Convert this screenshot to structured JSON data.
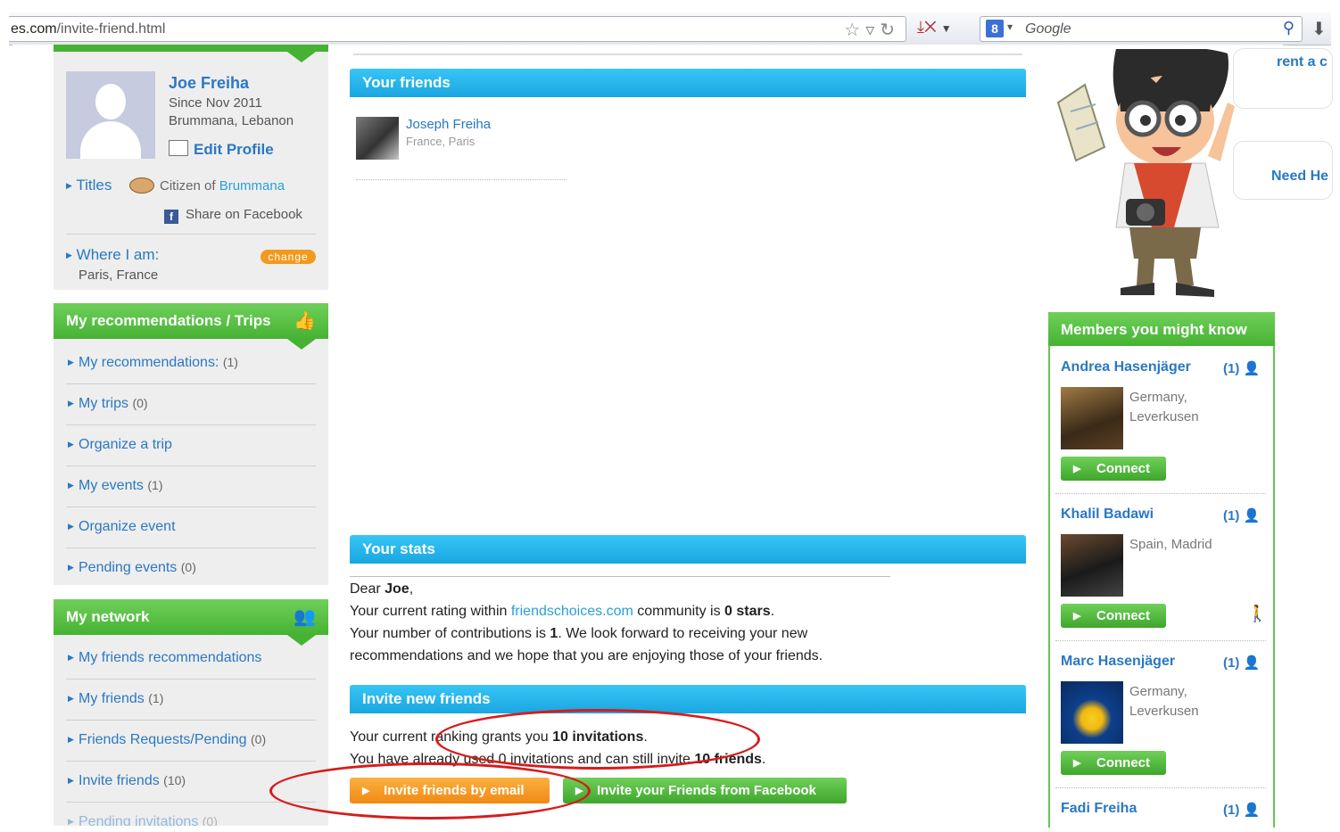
{
  "browser": {
    "url_domain": "es.com",
    "url_path": "/invite-friend.html",
    "search_placeholder": "Google",
    "search_engine_letter": "8"
  },
  "profile": {
    "name": "Joe Freiha",
    "since": "Since Nov 2011",
    "town": "Brummana, Lebanon",
    "edit_label": "Edit Profile",
    "titles_label": "Titles",
    "citizen_prefix": "Citizen of",
    "citizen_place": "Brummana",
    "share_label": "Share on Facebook",
    "where_label": "Where I am:",
    "change_label": "change",
    "location": "Paris, France"
  },
  "recommendations": {
    "title": "My recommendations / Trips",
    "items": [
      {
        "label": "My recommendations:",
        "count": "(1)"
      },
      {
        "label": "My trips",
        "count": "(0)"
      },
      {
        "label": "Organize a trip",
        "count": ""
      },
      {
        "label": "My events",
        "count": "(1)"
      },
      {
        "label": "Organize event",
        "count": ""
      },
      {
        "label": "Pending events",
        "count": "(0)"
      }
    ]
  },
  "network": {
    "title": "My network",
    "items": [
      {
        "label": "My friends recommendations",
        "count": ""
      },
      {
        "label": "My friends",
        "count": "(1)"
      },
      {
        "label": "Friends Requests/Pending",
        "count": "(0)"
      },
      {
        "label": "Invite friends",
        "count": "(10)"
      },
      {
        "label": "Pending invitations",
        "count": "(0)"
      }
    ]
  },
  "friends": {
    "title": "Your friends",
    "list": [
      {
        "name": "Joseph Freiha",
        "location": "France, Paris"
      }
    ]
  },
  "stats": {
    "title": "Your stats",
    "greeting_prefix": "Dear ",
    "greeting_name": "Joe",
    "greeting_suffix": ",",
    "rating_prefix": "Your current rating within ",
    "rating_site": "friendschoices.com",
    "rating_mid": " community is ",
    "rating_value": "0 stars",
    "rating_suffix": ".",
    "contrib_prefix": "Your number of contributions is ",
    "contrib_value": "1",
    "contrib_suffix": ". We look forward to receiving your new",
    "contrib_line2": "recommendations and we hope that you are enjoying those of your friends."
  },
  "invite": {
    "title": "Invite new friends",
    "line1_prefix": "Your current ranking grants you ",
    "line1_value": "10 invitations",
    "line1_suffix": ".",
    "line2_prefix": "You have already used 0 invitations and can still invite ",
    "line2_value": "10 friends",
    "line2_suffix": ".",
    "email_button": "Invite friends by email",
    "facebook_button": "Invite your Friends from Facebook"
  },
  "promo": {
    "bubble1": "rent a c",
    "bubble2": "Need He"
  },
  "members": {
    "title": "Members you might know",
    "connect_label": "Connect",
    "list": [
      {
        "name": "Andrea Hasenjäger",
        "count": "(1)",
        "loc1": "Germany,",
        "loc2": "Leverkusen"
      },
      {
        "name": "Khalil Badawi",
        "count": "(1)",
        "loc1": "Spain, Madrid",
        "loc2": ""
      },
      {
        "name": "Marc Hasenjäger",
        "count": "(1)",
        "loc1": "Germany,",
        "loc2": "Leverkusen"
      },
      {
        "name": "Fadi Freiha",
        "count": "(1)",
        "loc1": "",
        "loc2": ""
      }
    ]
  },
  "colors": {
    "green_accent": "#46b233",
    "blue_accent": "#1aa6e0",
    "orange_accent": "#f08a14",
    "link_blue": "#2a78c2",
    "annotation_red": "#d61c1c"
  }
}
